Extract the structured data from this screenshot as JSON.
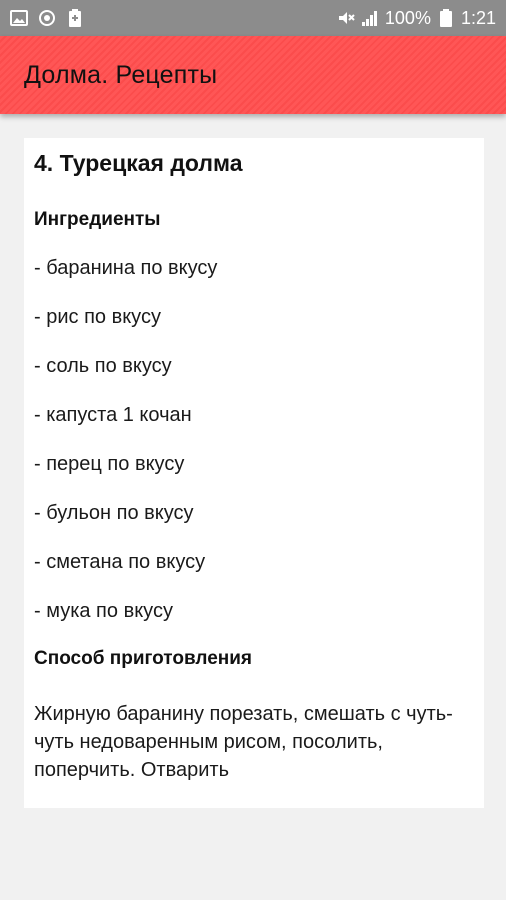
{
  "status_bar": {
    "battery_percent": "100%",
    "time": "1:21",
    "icons": [
      "image-icon",
      "sync-icon",
      "battery-saver-icon",
      "mute-icon",
      "signal-icon",
      "battery-icon"
    ]
  },
  "app_bar": {
    "title": "Долма. Рецепты",
    "color": "#ff5656"
  },
  "recipe": {
    "title": "4. Турецкая долма",
    "ingredients_heading": "Ингредиенты",
    "ingredients": [
      "- баранина по вкусу",
      "- рис по вкусу",
      "- соль по вкусу",
      "- капуста 1 кочан",
      "- перец по вкусу",
      "- бульон по вкусу",
      "- сметана по вкусу",
      "- мука по вкусу"
    ],
    "method_heading": "Способ приготовления",
    "method_text": "Жирную баранину порезать, смешать с чуть-чуть недоваренным рисом, посолить, поперчить. Отварить"
  }
}
